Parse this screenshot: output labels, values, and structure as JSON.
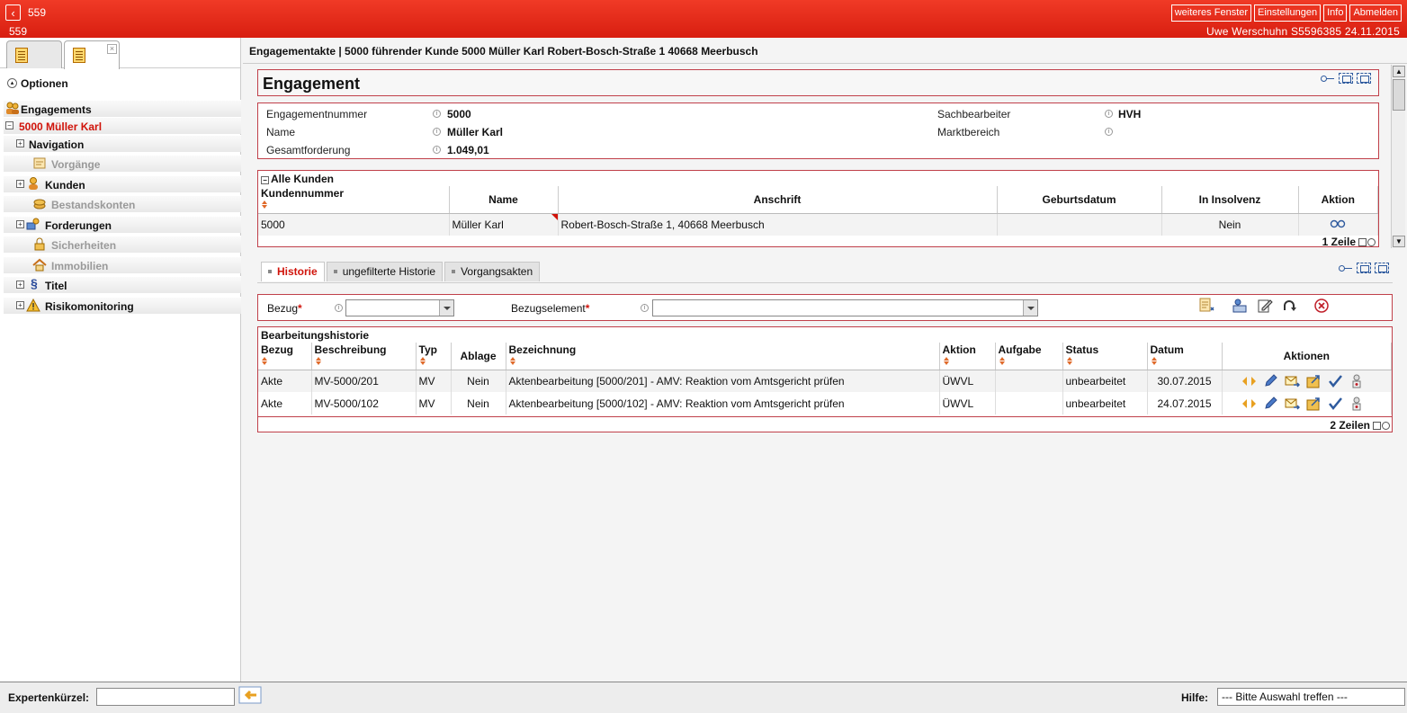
{
  "topbar": {
    "back_icon": "chevron-left-icon",
    "title": "559",
    "subtitle": "559",
    "buttons": [
      "weiteres Fenster",
      "Einstellungen",
      "Info",
      "Abmelden"
    ],
    "user_info": "Uwe Werschuhn S5596385   24.11.2015",
    "color": "#e02a1a"
  },
  "sidebar": {
    "options_label": "Optionen",
    "items": [
      {
        "label": "Engagements",
        "icon": "people-icon"
      },
      {
        "label": "5000 Müller Karl"
      },
      {
        "label": "Navigation"
      },
      {
        "label": "Vorgänge",
        "icon": "process-icon"
      },
      {
        "label": "Kunden",
        "icon": "customer-icon"
      },
      {
        "label": "Bestandskonten",
        "icon": "coins-icon"
      },
      {
        "label": "Forderungen",
        "icon": "claims-icon"
      },
      {
        "label": "Sicherheiten",
        "icon": "lock-icon"
      },
      {
        "label": "Immobilien",
        "icon": "house-icon"
      },
      {
        "label": "Titel",
        "icon": "paragraph-icon"
      },
      {
        "label": "Risikomonitoring",
        "icon": "warning-icon"
      }
    ]
  },
  "breadcrumb": "Engagementakte |  5000 führender Kunde 5000 Müller Karl Robert-Bosch-Straße 1 40668 Meerbusch",
  "engagement": {
    "title": "Engagement",
    "fields": {
      "engagementnummer_label": "Engagementnummer",
      "engagementnummer_value": "5000",
      "name_label": "Name",
      "name_value": "Müller Karl",
      "gesamtforderung_label": "Gesamtforderung",
      "gesamtforderung_value": "1.049,01",
      "sachbearbeiter_label": "Sachbearbeiter",
      "sachbearbeiter_value": "HVH",
      "marktbereich_label": "Marktbereich",
      "marktbereich_value": ""
    }
  },
  "customers": {
    "section_title": "Alle Kunden",
    "columns": [
      "Kundennummer",
      "Name",
      "Anschrift",
      "Geburtsdatum",
      "In Insolvenz",
      "Aktion"
    ],
    "rows": [
      {
        "kundennummer": "5000",
        "name": "Müller Karl",
        "anschrift": "Robert-Bosch-Straße 1, 40668 Meerbusch",
        "geburtsdatum": "",
        "insolvenz": "Nein",
        "aktion_icon": "glasses-icon"
      }
    ],
    "footer": "1 Zeile"
  },
  "tabs": [
    "Historie",
    "ungefilterte Historie",
    "Vorgangsakten"
  ],
  "filter": {
    "bezug_label": "Bezug",
    "bezug_value": "",
    "bezugselement_label": "Bezugselement",
    "bezugselement_value": "",
    "required_mark": "*"
  },
  "history": {
    "section_title": "Bearbeitungshistorie",
    "columns": [
      "Bezug",
      "Beschreibung",
      "Typ",
      "Ablage",
      "Bezeichnung",
      "Aktion",
      "Aufgabe",
      "Status",
      "Datum",
      "Aktionen"
    ],
    "rows": [
      {
        "bezug": "Akte",
        "beschreibung": "MV-5000/201",
        "typ": "MV",
        "ablage": "Nein",
        "bezeichnung": "Aktenbearbeitung [5000/201] - AMV: Reaktion vom Amtsgericht prüfen",
        "aktion": "ÜWVL",
        "aufgabe": "",
        "status": "unbearbeitet",
        "datum": "30.07.2015"
      },
      {
        "bezug": "Akte",
        "beschreibung": "MV-5000/102",
        "typ": "MV",
        "ablage": "Nein",
        "bezeichnung": "Aktenbearbeitung [5000/102] - AMV: Reaktion vom Amtsgericht prüfen",
        "aktion": "ÜWVL",
        "aufgabe": "",
        "status": "unbearbeitet",
        "datum": "24.07.2015"
      }
    ],
    "footer": "2 Zeilen"
  },
  "bottom": {
    "expert_label": "Expertenkürzel:",
    "expert_value": "",
    "help_label": "Hilfe:",
    "help_select": "--- Bitte Auswahl treffen ---"
  }
}
